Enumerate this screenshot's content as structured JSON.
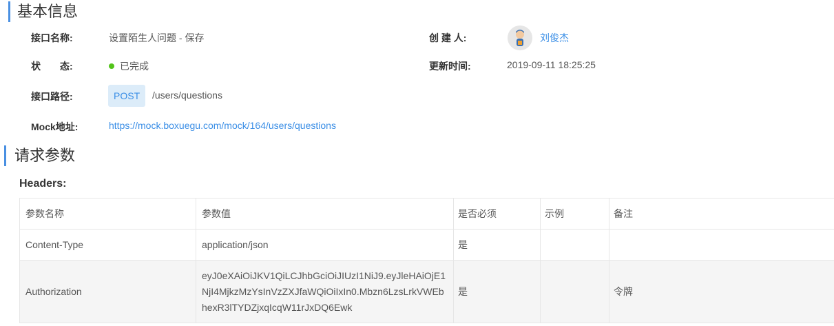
{
  "basic_info": {
    "title": "基本信息",
    "api_name_label": "接口名称:",
    "api_name": "设置陌生人问题 - 保存",
    "creator_label": "创 建 人:",
    "creator": "刘俊杰",
    "status_label": "状　　态:",
    "status": "已完成",
    "status_color": "#52c41a",
    "updated_label": "更新时间:",
    "updated": "2019-09-11 18:25:25",
    "path_label": "接口路径:",
    "method": "POST",
    "path": "/users/questions",
    "mock_label": "Mock地址:",
    "mock_url": "https://mock.boxuegu.com/mock/164/users/questions"
  },
  "request_params": {
    "title": "请求参数",
    "headers_label": "Headers:",
    "columns": [
      "参数名称",
      "参数值",
      "是否必须",
      "示例",
      "备注"
    ],
    "rows": [
      {
        "name": "Content-Type",
        "value": "application/json",
        "required": "是",
        "example": "",
        "note": ""
      },
      {
        "name": "Authorization",
        "value": "eyJ0eXAiOiJKV1QiLCJhbGciOiJIUzI1NiJ9.eyJleHAiOjE1NjI4MjkzMzYsInVzZXJfaWQiOiIxIn0.Mbzn6LzsLrkVWEbhexR3lTYDZjxqIcqW11rJxDQ6Ewk",
        "required": "是",
        "example": "",
        "note": "令牌"
      }
    ]
  },
  "colors": {
    "accent": "#4a90e2",
    "link": "#3a8ee6",
    "badge_bg": "#dcecf9"
  }
}
